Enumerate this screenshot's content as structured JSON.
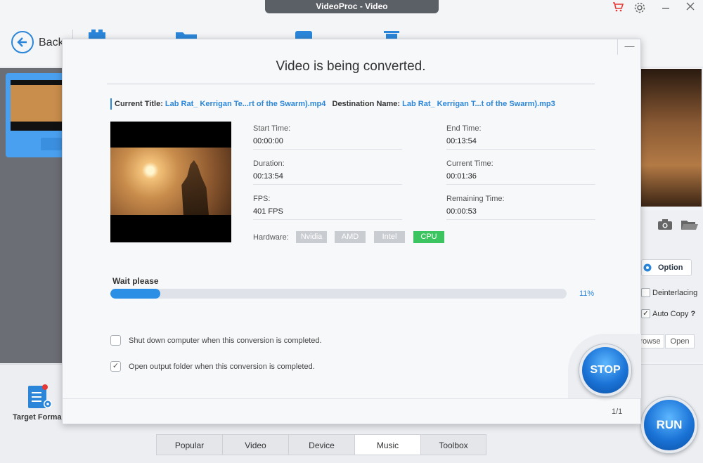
{
  "window": {
    "title": "VideoProc - Video"
  },
  "toolbar": {
    "back_label": "Back"
  },
  "left_panel": {},
  "right_panel": {
    "option_label": "Option",
    "deinterlacing_label": "Deinterlacing",
    "deinterlacing_checked": false,
    "auto_copy_label": "Auto Copy",
    "auto_copy_checked": true,
    "auto_copy_help": "?",
    "browse_label": "rowse",
    "open_label": "Open"
  },
  "bottom": {
    "target_format_label": "Target Forma",
    "tabs": [
      {
        "label": "Popular",
        "active": false
      },
      {
        "label": "Video",
        "active": false
      },
      {
        "label": "Device",
        "active": false
      },
      {
        "label": "Music",
        "active": true
      },
      {
        "label": "Toolbox",
        "active": false
      }
    ],
    "run_label": "RUN"
  },
  "dialog": {
    "heading": "Video is being converted.",
    "current_title_label": "Current Title:",
    "current_title_value": "Lab Rat_ Kerrigan Te...rt of the Swarm).mp4",
    "destination_label": "Destination Name:",
    "destination_value": "Lab Rat_ Kerrigan T...t of the Swarm).mp3",
    "start_time_label": "Start Time:",
    "start_time_value": "00:00:00",
    "end_time_label": "End Time:",
    "end_time_value": "00:13:54",
    "duration_label": "Duration:",
    "duration_value": "00:13:54",
    "current_time_label": "Current Time:",
    "current_time_value": "00:01:36",
    "fps_label": "FPS:",
    "fps_value": "401 FPS",
    "remaining_label": "Remaining Time:",
    "remaining_value": "00:00:53",
    "hardware_label": "Hardware:",
    "hardware": [
      {
        "label": "Nvidia",
        "active": false
      },
      {
        "label": "AMD",
        "active": false
      },
      {
        "label": "Intel",
        "active": false
      },
      {
        "label": "CPU",
        "active": true
      }
    ],
    "wait_label": "Wait please",
    "progress_percent": 11,
    "progress_text": "11%",
    "shutdown_label": "Shut down computer when this conversion is completed.",
    "shutdown_checked": false,
    "open_folder_label": "Open output folder when this conversion is completed.",
    "open_folder_checked": true,
    "stop_label": "STOP",
    "page_count": "1/1",
    "minimize_symbol": "—"
  },
  "colors": {
    "accent": "#2b86d9",
    "active_hw": "#3cc460",
    "inactive_hw": "#c9ccd1"
  },
  "icons": {
    "cart": "cart-icon",
    "settings": "gear-icon",
    "close": "close-icon",
    "back": "back-arrow-icon",
    "camera": "camera-icon",
    "folder": "folder-icon"
  }
}
